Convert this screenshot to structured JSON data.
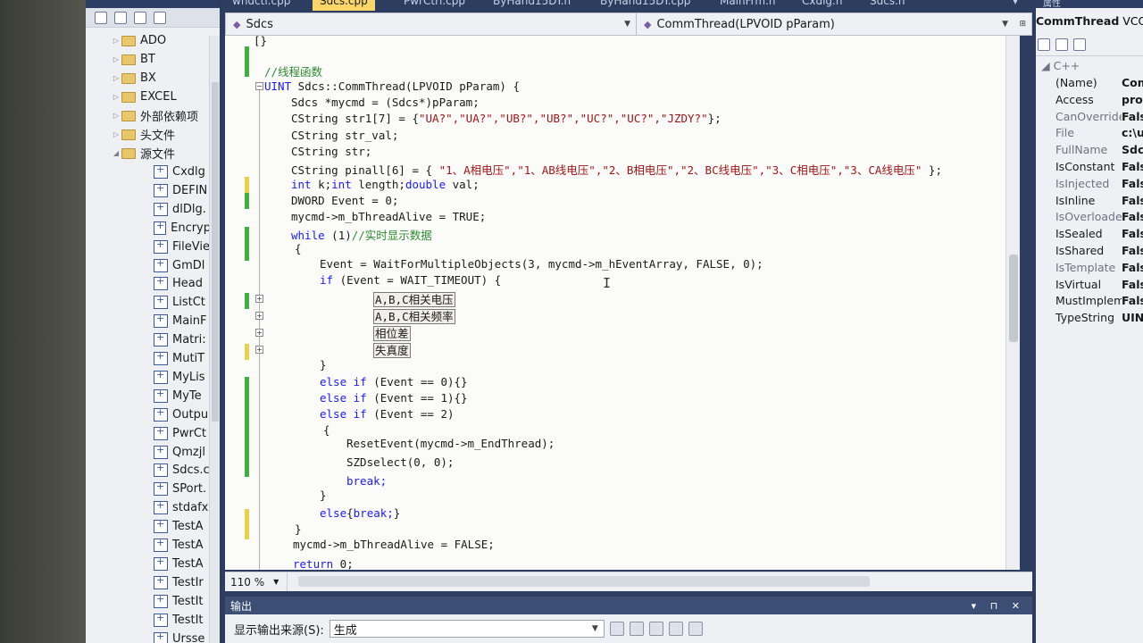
{
  "tabs": [
    "wndctl.cpp",
    "Sdcs.cpp",
    "PwrCtrl.cpp",
    "ByHand15DY.h",
    "ByHand15DY.cpp",
    "MainFrm.h",
    "Cxdlg.h",
    "Sdcs.h"
  ],
  "solution_explorer": {
    "folders": [
      "ADO",
      "BT",
      "BX",
      "EXCEL",
      "外部依赖项",
      "头文件",
      "源文件"
    ],
    "files": [
      "Cxdlg",
      "DEFIN",
      "dlDlg.",
      "Encryp",
      "FileVie",
      "GmDl",
      "Head",
      "ListCt",
      "MainF",
      "Matri:",
      "MutiT",
      "MyLis",
      "MyTe",
      "Outpu",
      "PwrCt",
      "Qmzjl",
      "Sdcs.c",
      "SPort.",
      "stdafx",
      "TestA",
      "TestA",
      "TestA",
      "TestIr",
      "TestIt",
      "TestIt",
      "Ursse"
    ]
  },
  "navbar": {
    "class_scope": "Sdcs",
    "member_scope": "CommThread(LPVOID pParam)"
  },
  "code": {
    "brace_top": "[}",
    "comment_thread_fn": "//线程函数",
    "signature": "UINT Sdcs::CommThread(LPVOID pParam) {",
    "l_mycmd_decl": "Sdcs *mycmd = (Sdcs*)pParam;",
    "l_str1_type": "CString str1[7] = {",
    "l_str1_vals": "\"UA?\",\"UA?\",\"UB?\",\"UB?\",\"UC?\",\"UC?\",\"JZDY?\"",
    "l_str1_end": "};",
    "l_str_val": "CString str_val;",
    "l_str": "CString str;",
    "l_pinall_type": "CString pinall[6] = { ",
    "l_pinall_vals": "\"1、A相电压\",\"1、AB线电压\",\"2、B相电压\",\"2、BC线电压\",\"3、C相电压\",\"3、CA线电压\"",
    "l_pinall_end": " };",
    "l_int_kw1": "int",
    "l_int_mid": " k;",
    "l_int_kw2": "int",
    "l_int_mid2": " length;",
    "l_int_kw3": "double",
    "l_int_end": " val;",
    "l_dword": "DWORD Event = 0;",
    "l_alive_true": "mycmd->m_bThreadAlive = TRUE;",
    "l_while_kw": "while",
    "l_while_rest": " (1)",
    "l_while_cm": "//实时显示数据",
    "l_open1": "{",
    "l_wait": "Event = WaitForMultipleObjects(3, mycmd->m_hEventArray, FALSE, 0);",
    "l_if_kw": "if",
    "l_if_rest": " (Event = WAIT_TIMEOUT) {",
    "region1": "A,B,C相关电压",
    "region2": "A,B,C相关频率",
    "region3": "相位差",
    "region4": "失真度",
    "l_close_if": "}",
    "l_elseif0_kw": "else if",
    "l_elseif0_rest": " (Event == 0){}",
    "l_elseif1_kw": "else if",
    "l_elseif1_rest": " (Event == 1){}",
    "l_elseif2_kw": "else if",
    "l_elseif2_rest": " (Event == 2)",
    "l_open2": "{",
    "l_reset": "ResetEvent(mycmd->m_EndThread);",
    "l_szd": "SZDselect(0, 0);",
    "l_break": "break;",
    "l_close2": "}",
    "l_else_kw": "else",
    "l_else_open": "{",
    "l_else_break": "break;",
    "l_else_close": "}",
    "l_close_while": "}",
    "l_alive_false": "mycmd->m_bThreadAlive = FALSE;",
    "l_return_kw": "return",
    "l_return_rest": " 0;"
  },
  "status": {
    "zoom": "110 %"
  },
  "output_panel": {
    "title": "输出",
    "source_label": "显示输出来源(S):",
    "source_value": "生成"
  },
  "properties": {
    "header_title": "CommThread",
    "header_type": "VCCo",
    "top_label": "属性",
    "category": "C++",
    "rows": [
      {
        "name": "(Name)",
        "value": "Com"
      },
      {
        "name": "Access",
        "value": "prot"
      },
      {
        "name": "CanOverride",
        "value": "Fals"
      },
      {
        "name": "File",
        "value": "c:\\u"
      },
      {
        "name": "FullName",
        "value": "Sdcs"
      },
      {
        "name": "IsConstant",
        "value": "Fals"
      },
      {
        "name": "IsInjected",
        "value": "Fals"
      },
      {
        "name": "IsInline",
        "value": "Fals"
      },
      {
        "name": "IsOverloaded",
        "value": "Fals"
      },
      {
        "name": "IsSealed",
        "value": "Fals"
      },
      {
        "name": "IsShared",
        "value": "Fals"
      },
      {
        "name": "IsTemplate",
        "value": "Fals"
      },
      {
        "name": "IsVirtual",
        "value": "Fals"
      },
      {
        "name": "MustImplement",
        "value": "Fals"
      },
      {
        "name": "TypeString",
        "value": "UIN"
      }
    ]
  },
  "colors": {
    "keyword": "#1a1aff",
    "comment": "#2e8b2e",
    "string": "#a31515",
    "change_saved": "#3fb03f",
    "change_unsaved": "#e6d24a",
    "active_tab": "#f9d56a"
  }
}
